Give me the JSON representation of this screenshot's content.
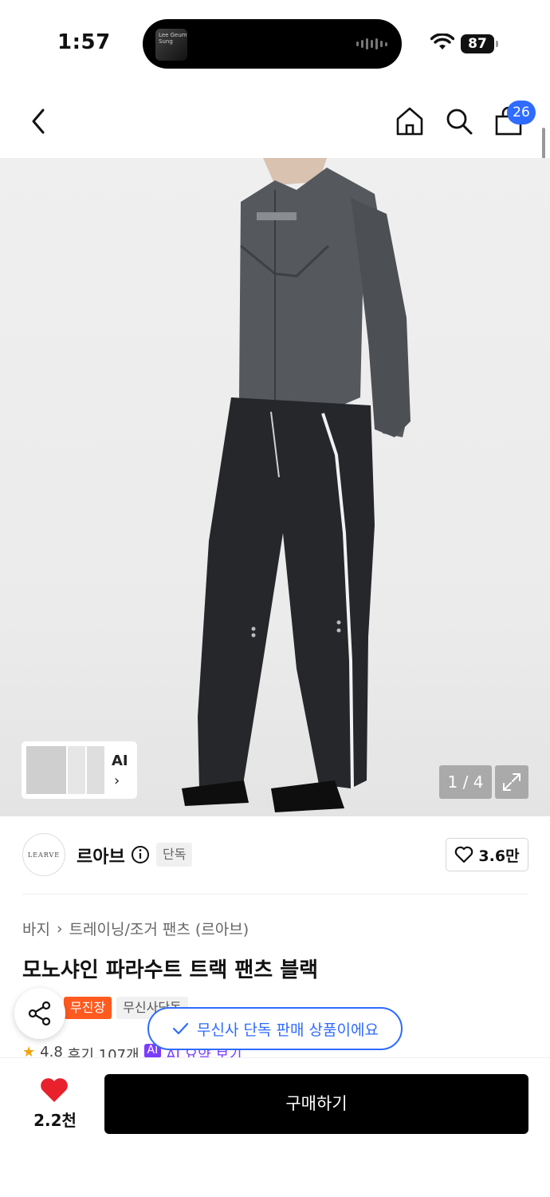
{
  "status_bar": {
    "time": "1:57",
    "battery": "87",
    "now_playing_art_text": "Lee Geum Sung"
  },
  "top_nav": {
    "cart_count": "26"
  },
  "gallery": {
    "page_counter": "1 / 4",
    "ai_label": "AI",
    "ai_chevron": "›"
  },
  "brand": {
    "logo_text": "LEARVE",
    "name": "르아브",
    "exclusive_tag": "단독",
    "likes": "3.6만"
  },
  "product": {
    "breadcrumb": [
      "바지",
      "트레이닝/조거 팬츠 (르아브)"
    ],
    "breadcrumb_sep": "›",
    "title": "모노샤인 파라수트 트랙 팬츠 블랙",
    "tags": [
      "무진장",
      "무신사단독"
    ],
    "rating": "4.8",
    "reviews": "후기 107개",
    "ai_chip": "AI",
    "ai_summary": "AI 요약 보기"
  },
  "toast": {
    "text": "무신사 단독 판매 상품이에요"
  },
  "bottom_bar": {
    "wish_count": "2.2천",
    "buy_label": "구매하기"
  },
  "colors": {
    "accent_blue": "#2f6bff",
    "tag_orange": "#ff5a1f",
    "heart_red": "#e8212c",
    "buy_black": "#000000"
  }
}
